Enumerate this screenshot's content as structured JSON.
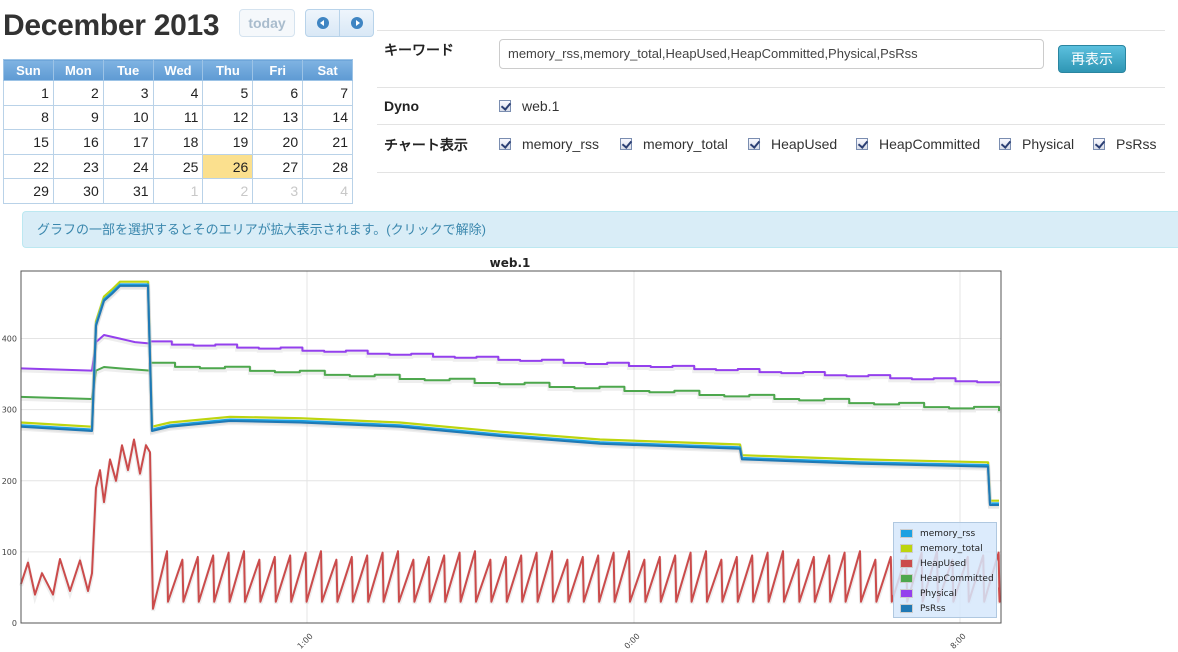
{
  "calendar": {
    "title": "December 2013",
    "today_label": "today",
    "weekdays": [
      "Sun",
      "Mon",
      "Tue",
      "Wed",
      "Thu",
      "Fri",
      "Sat"
    ],
    "weeks": [
      [
        "1",
        "2",
        "3",
        "4",
        "5",
        "6",
        "7"
      ],
      [
        "8",
        "9",
        "10",
        "11",
        "12",
        "13",
        "14"
      ],
      [
        "15",
        "16",
        "17",
        "18",
        "19",
        "20",
        "21"
      ],
      [
        "22",
        "23",
        "24",
        "25",
        "26",
        "27",
        "28"
      ],
      [
        "29",
        "30",
        "31",
        "1",
        "2",
        "3",
        "4"
      ]
    ],
    "highlighted_day": "26"
  },
  "form": {
    "keyword_label": "キーワード",
    "keyword_value": "memory_rss,memory_total,HeapUsed,HeapCommitted,Physical,PsRss",
    "redisplay_label": "再表示",
    "dyno_label": "Dyno",
    "dyno_option": "web.1",
    "chart_display_label": "チャート表示",
    "chart_options": [
      "memory_rss",
      "memory_total",
      "HeapUsed",
      "HeapCommitted",
      "Physical",
      "PsRss"
    ]
  },
  "info_message": "グラフの一部を選択するとそのエリアが拡大表示されます。(クリックで解除)",
  "chart_data": {
    "type": "line",
    "title": "web.1",
    "x_tick_labels": [
      "1:00",
      "0:00",
      "8:00"
    ],
    "y_ticks": [
      0,
      100,
      200,
      300,
      400
    ],
    "ylim": [
      0,
      495
    ],
    "grid": true,
    "legend_position": "bottom-right",
    "series": [
      {
        "name": "memory_rss",
        "color": "#1ba1e2"
      },
      {
        "name": "memory_total",
        "color": "#bdd50f"
      },
      {
        "name": "HeapUsed",
        "color": "#cb4b4b"
      },
      {
        "name": "HeapCommitted",
        "color": "#4da74d"
      },
      {
        "name": "Physical",
        "color": "#9440ed"
      },
      {
        "name": "PsRss",
        "color": "#1f78b4"
      }
    ]
  }
}
